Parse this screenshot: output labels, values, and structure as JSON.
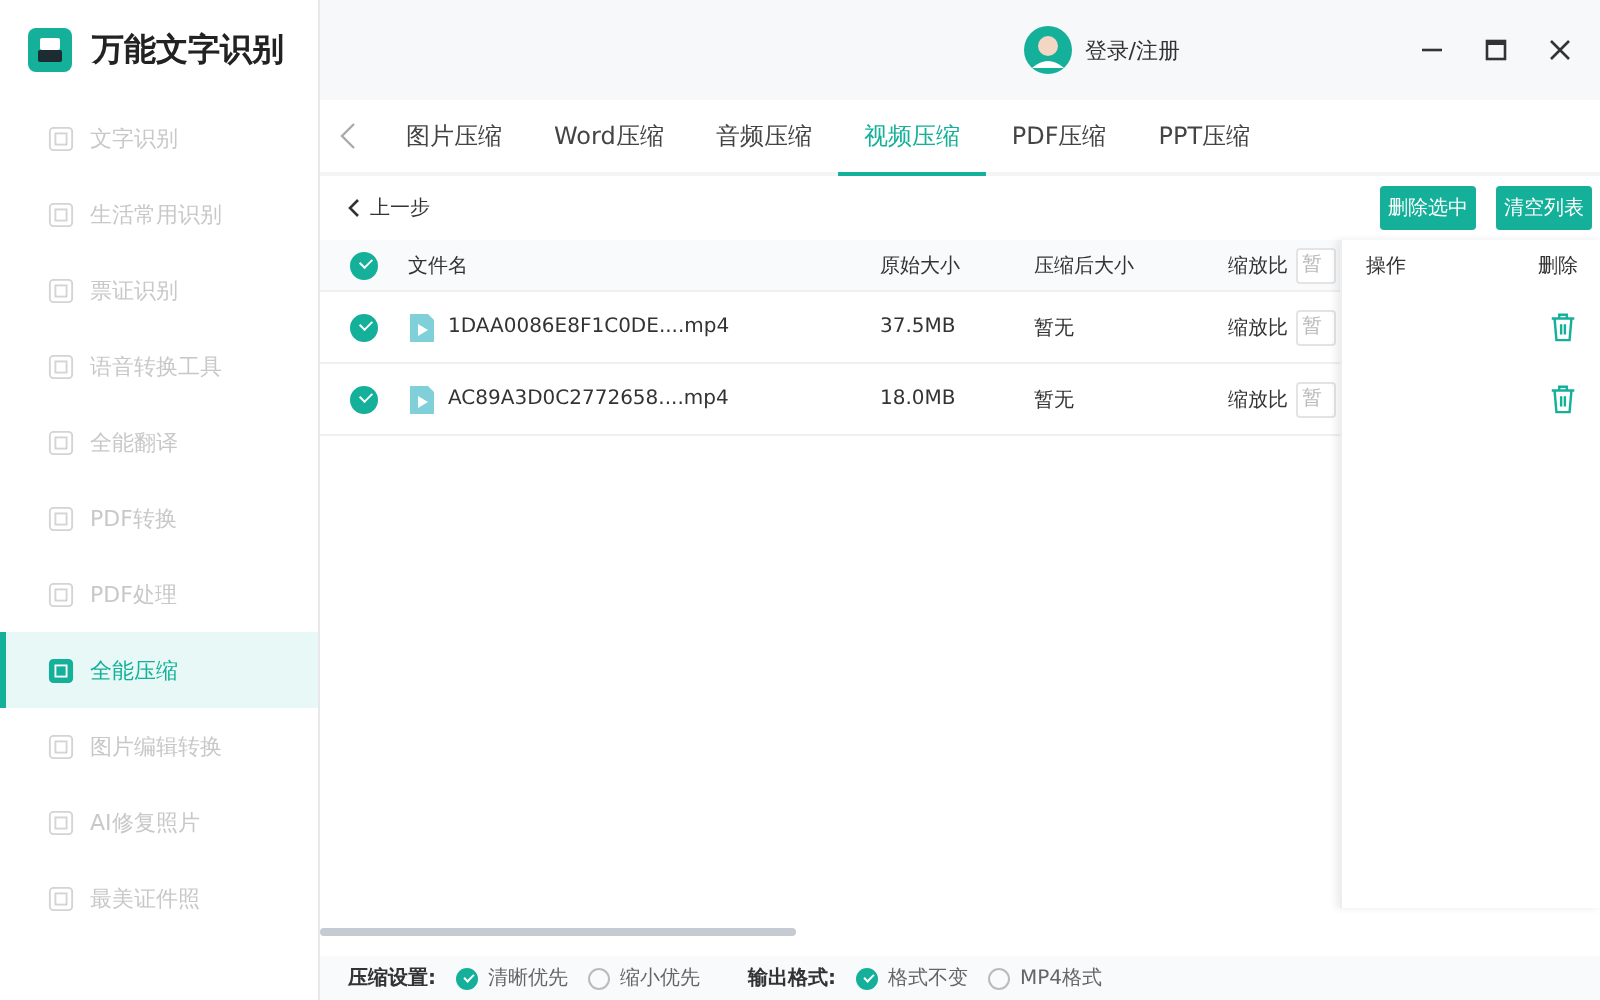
{
  "app": {
    "title": "万能文字识别"
  },
  "user": {
    "label": "登录/注册"
  },
  "sidebar": {
    "items": [
      {
        "label": "文字识别",
        "selected": false
      },
      {
        "label": "生活常用识别",
        "selected": false
      },
      {
        "label": "票证识别",
        "selected": false
      },
      {
        "label": "语音转换工具",
        "selected": false
      },
      {
        "label": "全能翻译",
        "selected": false
      },
      {
        "label": "PDF转换",
        "selected": false
      },
      {
        "label": "PDF处理",
        "selected": false
      },
      {
        "label": "全能压缩",
        "selected": true
      },
      {
        "label": "图片编辑转换",
        "selected": false
      },
      {
        "label": "AI修复照片",
        "selected": false
      },
      {
        "label": "最美证件照",
        "selected": false
      }
    ]
  },
  "tabs": [
    {
      "label": "图片压缩",
      "selected": false
    },
    {
      "label": "Word压缩",
      "selected": false
    },
    {
      "label": "音频压缩",
      "selected": false
    },
    {
      "label": "视频压缩",
      "selected": true
    },
    {
      "label": "PDF压缩",
      "selected": false
    },
    {
      "label": "PPT压缩",
      "selected": false
    }
  ],
  "back": {
    "label": "上一步"
  },
  "actions": [
    "删除选中",
    "清空列表"
  ],
  "table": {
    "all_checked": true,
    "columns": [
      "文件名",
      "原始大小",
      "压缩后大小",
      "缩放比"
    ],
    "scale_placeholder": "暂",
    "rows": [
      {
        "checked": true,
        "name": "1DAA0086E8F1C0DE....mp4",
        "size": "37.5MB",
        "compressed": "暂无",
        "scale_label": "缩放比",
        "scale_placeholder": "暂"
      },
      {
        "checked": true,
        "name": "AC89A3D0C2772658....mp4",
        "size": "18.0MB",
        "compressed": "暂无",
        "scale_label": "缩放比",
        "scale_placeholder": "暂"
      }
    ]
  },
  "panel": {
    "columns": [
      "操作",
      "删除"
    ]
  },
  "settings": {
    "groups": [
      {
        "label": "压缩设置:",
        "options": [
          {
            "label": "清晰优先",
            "selected": true
          },
          {
            "label": "缩小优先",
            "selected": false
          }
        ]
      },
      {
        "label": "输出格式:",
        "options": [
          {
            "label": "格式不变",
            "selected": true
          },
          {
            "label": "MP4格式",
            "selected": false
          }
        ]
      }
    ]
  }
}
